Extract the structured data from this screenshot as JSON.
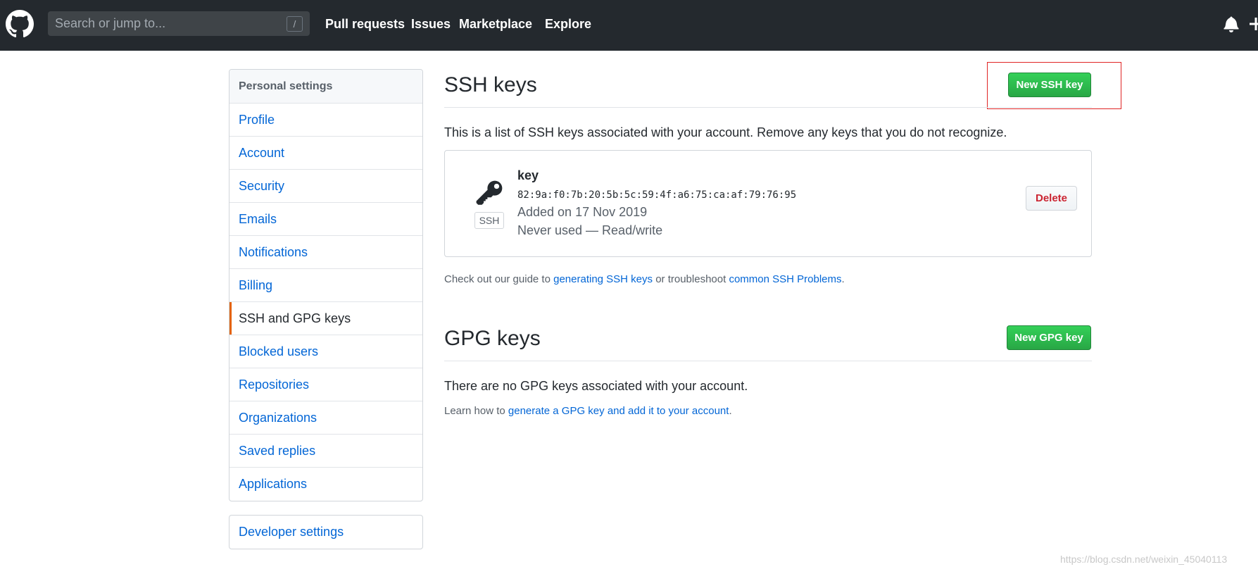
{
  "header": {
    "search_placeholder": "Search or jump to...",
    "search_shortcut": "/",
    "nav": [
      "Pull requests",
      "Issues",
      "Marketplace",
      "Explore"
    ]
  },
  "sidebar": {
    "heading": "Personal settings",
    "items": [
      {
        "label": "Profile"
      },
      {
        "label": "Account"
      },
      {
        "label": "Security"
      },
      {
        "label": "Emails"
      },
      {
        "label": "Notifications"
      },
      {
        "label": "Billing"
      },
      {
        "label": "SSH and GPG keys",
        "selected": true
      },
      {
        "label": "Blocked users"
      },
      {
        "label": "Repositories"
      },
      {
        "label": "Organizations"
      },
      {
        "label": "Saved replies"
      },
      {
        "label": "Applications"
      }
    ],
    "developer_settings": "Developer settings"
  },
  "ssh": {
    "title": "SSH keys",
    "new_button": "New SSH key",
    "description": "This is a list of SSH keys associated with your account. Remove any keys that you do not recognize.",
    "key": {
      "name": "key",
      "fingerprint": "82:9a:f0:7b:20:5b:5c:59:4f:a6:75:ca:af:79:76:95",
      "badge": "SSH",
      "added": "Added on 17 Nov 2019",
      "usage": "Never used — Read/write",
      "delete_button": "Delete"
    },
    "guide_prefix": "Check out our guide to ",
    "guide_link1": "generating SSH keys",
    "guide_middle": " or troubleshoot ",
    "guide_link2": "common SSH Problems",
    "guide_suffix": "."
  },
  "gpg": {
    "title": "GPG keys",
    "new_button": "New GPG key",
    "empty_text": "There are no GPG keys associated with your account.",
    "learn_prefix": "Learn how to ",
    "learn_link": "generate a GPG key and add it to your account",
    "learn_suffix": "."
  },
  "watermark": "https://blog.csdn.net/weixin_45040113"
}
